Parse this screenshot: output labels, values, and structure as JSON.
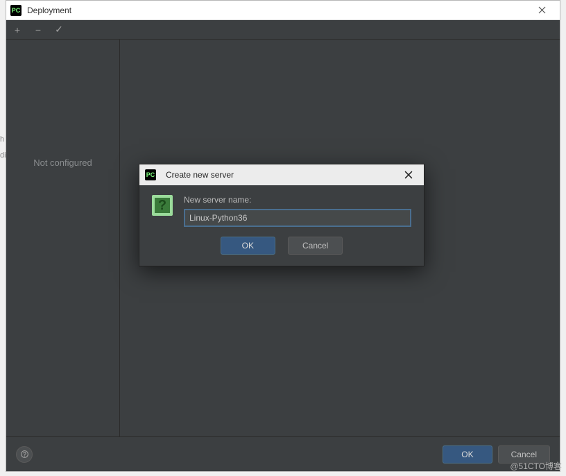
{
  "window": {
    "title": "Deployment",
    "app_icon_text": "PC"
  },
  "toolbar": {
    "add_glyph": "+",
    "remove_glyph": "−",
    "check_glyph": "✓"
  },
  "left_panel": {
    "status_text": "Not configured"
  },
  "modal": {
    "title": "Create new server",
    "label": "New server name:",
    "input_value": "Linux-Python36",
    "ok_label": "OK",
    "cancel_label": "Cancel",
    "question_glyph": "?"
  },
  "footer": {
    "ok_label": "OK",
    "cancel_label": "Cancel",
    "help_glyph": "?"
  },
  "watermark": "@51CTO博客"
}
